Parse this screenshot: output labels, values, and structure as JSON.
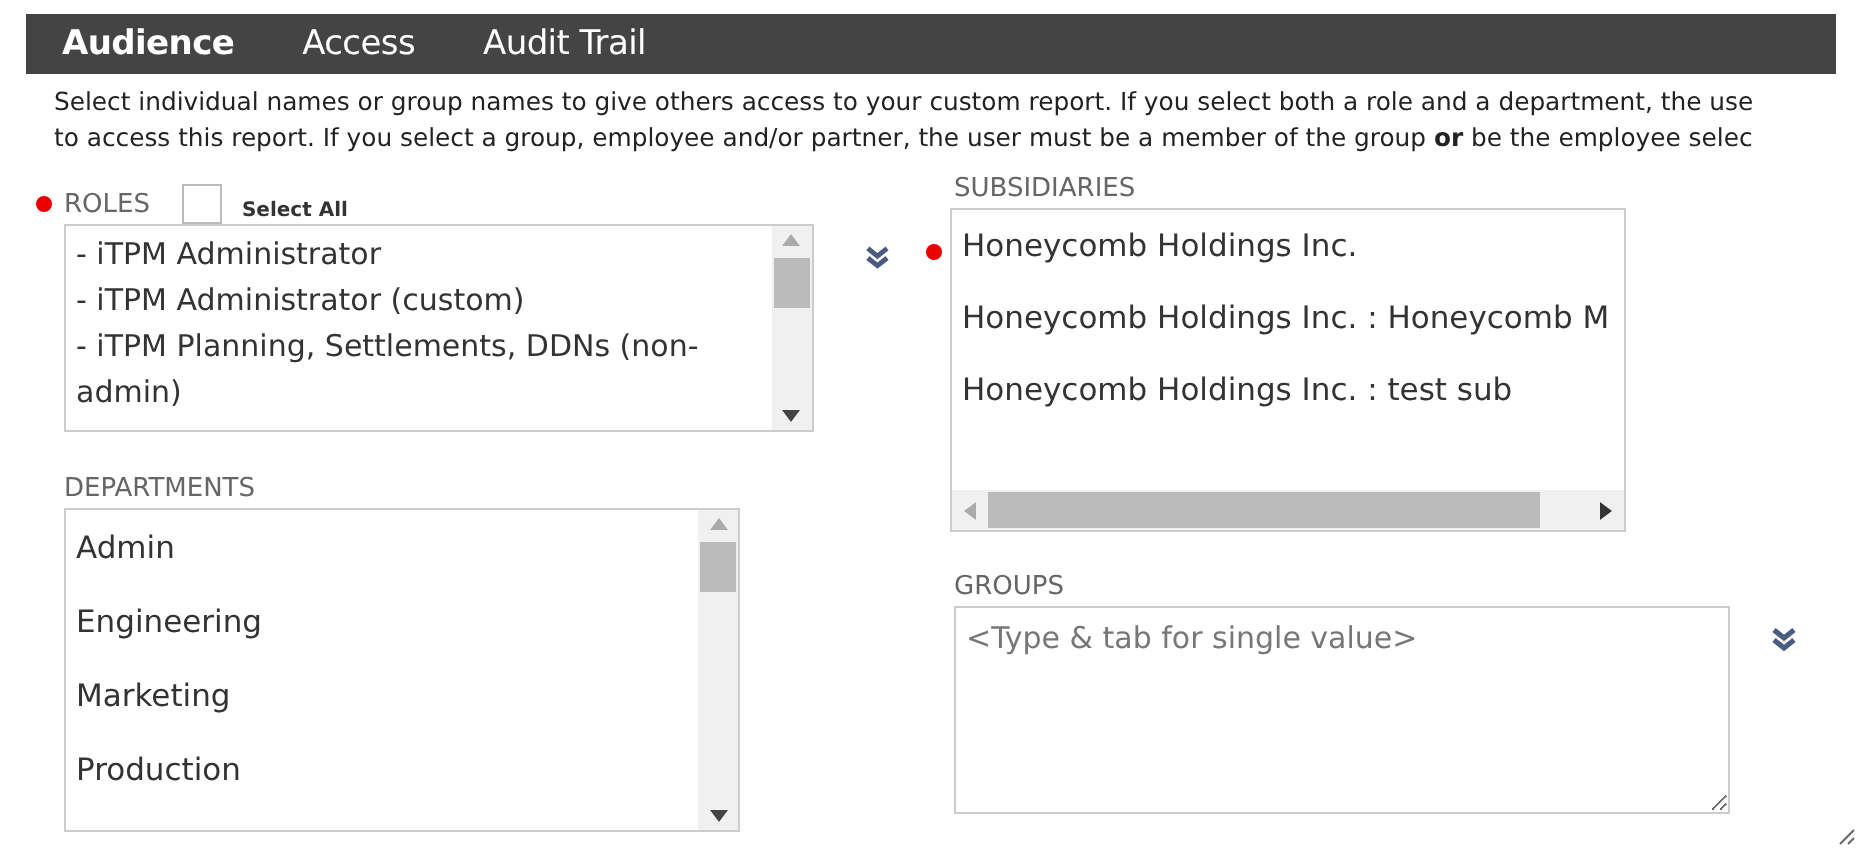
{
  "tabs": [
    {
      "label": "Audience",
      "selected": true
    },
    {
      "label": "Access",
      "selected": false
    },
    {
      "label": "Audit Trail",
      "selected": false
    }
  ],
  "intro_lines": [
    "Select individual names or group names to give others access to your custom report. If you select both a role and a department, the use",
    "to access this report. If you select a group, employee and/or partner, the user must be a member of the group **or** be the employee selec"
  ],
  "roles": {
    "label": "ROLES",
    "required": true,
    "select_all": {
      "label": "Select All",
      "checked": false
    },
    "items": [
      "- iTPM Administrator",
      "- iTPM Administrator (custom)",
      "- iTPM Planning, Settlements, DDNs (non-admin)"
    ]
  },
  "departments": {
    "label": "DEPARTMENTS",
    "items": [
      "Admin",
      "Engineering",
      "Marketing",
      "Production"
    ]
  },
  "subsidiaries": {
    "label": "SUBSIDIARIES",
    "required": true,
    "items": [
      "Honeycomb Holdings Inc.",
      "Honeycomb Holdings Inc. : Honeycomb M",
      "Honeycomb Holdings Inc. : test sub"
    ]
  },
  "groups": {
    "label": "GROUPS",
    "placeholder": "<Type & tab for single value>"
  }
}
